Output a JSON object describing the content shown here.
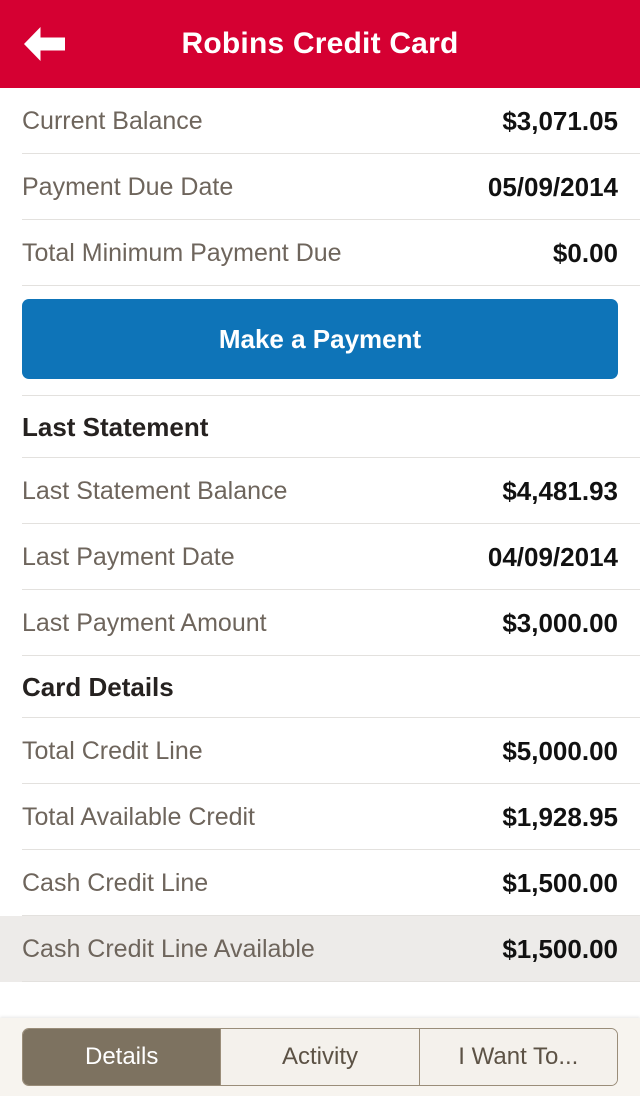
{
  "header": {
    "title": "Robins Credit Card",
    "back_icon": "back-arrow-icon",
    "background_color": "#D50032",
    "title_color": "#FFFFFF"
  },
  "summary": {
    "rows": [
      {
        "label": "Current Balance",
        "value": "$3,071.05"
      },
      {
        "label": "Payment Due Date",
        "value": "05/09/2014"
      },
      {
        "label": "Total Minimum Payment Due",
        "value": "$0.00"
      }
    ]
  },
  "cta": {
    "label": "Make a Payment",
    "color": "#0E74B8"
  },
  "last_statement": {
    "heading": "Last Statement",
    "rows": [
      {
        "label": "Last Statement Balance",
        "value": "$4,481.93"
      },
      {
        "label": "Last Payment Date",
        "value": "04/09/2014"
      },
      {
        "label": "Last Payment Amount",
        "value": "$3,000.00"
      }
    ]
  },
  "card_details": {
    "heading": "Card Details",
    "rows": [
      {
        "label": "Total Credit Line",
        "value": "$5,000.00"
      },
      {
        "label": "Total Available Credit",
        "value": "$1,928.95"
      },
      {
        "label": "Cash Credit Line",
        "value": "$1,500.00"
      },
      {
        "label": "Cash Credit Line Available",
        "value": "$1,500.00"
      }
    ]
  },
  "tabbar": {
    "tabs": [
      {
        "label": "Details",
        "selected": true
      },
      {
        "label": "Activity",
        "selected": false
      },
      {
        "label": "I Want To...",
        "selected": false
      }
    ],
    "selected_color": "#7D7260",
    "unselected_color": "#F4F1EC"
  }
}
